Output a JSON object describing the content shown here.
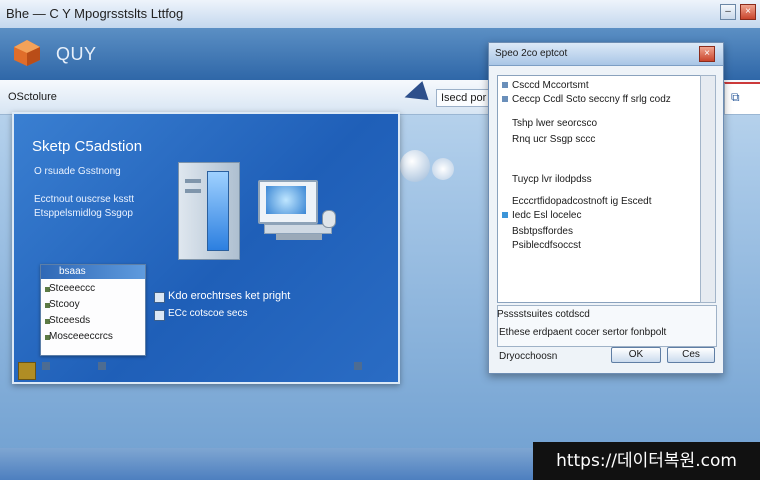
{
  "window": {
    "title": "Bhe — C Y Mpogrsstslts Lttfog"
  },
  "app": {
    "name": "QUY"
  },
  "toolbar": {
    "left_label": "OSctolure",
    "nav_label": "Isecd por"
  },
  "card": {
    "heading": "Sketp C5adstion",
    "sub1": "O rsuade Gsstnong",
    "sub2": "Ecctnout ouscrse ksstt",
    "sub3": "Etsppelsmidlog Ssgop",
    "option1": "Kdo erochtrses ket pright",
    "option2": "ECc cotscoe secs"
  },
  "mini_window": {
    "title": "bsaas",
    "items": [
      "Stceeeccc",
      "Stcooy",
      "Stceesds",
      "Mosceeeccrcs"
    ]
  },
  "dialog": {
    "title": "Speo 2co eptcot",
    "items": [
      "Csccd Mccortsmt",
      "Ceccp Ccdl Scto seccny ff srlg codz",
      "Tshp lwer seorcsco",
      "Rnq ucr Ssgp sccc",
      "Tuycp lvr ilodpdss",
      "Ecccrtfidopadcostnoft ig Escedt",
      "Iedc Esl locelec",
      "Bsbtpsffordes",
      "Psiblecdfsoccst"
    ],
    "group_title": "Psssstsuites cotdscd",
    "group_text": "Ethese erdpaent cocer sertor fonbpolt",
    "footer_label": "Dryocchoosn",
    "ok_label": "OK",
    "cancel_label": "Ces"
  },
  "watermark": "https://데이터복원.com"
}
